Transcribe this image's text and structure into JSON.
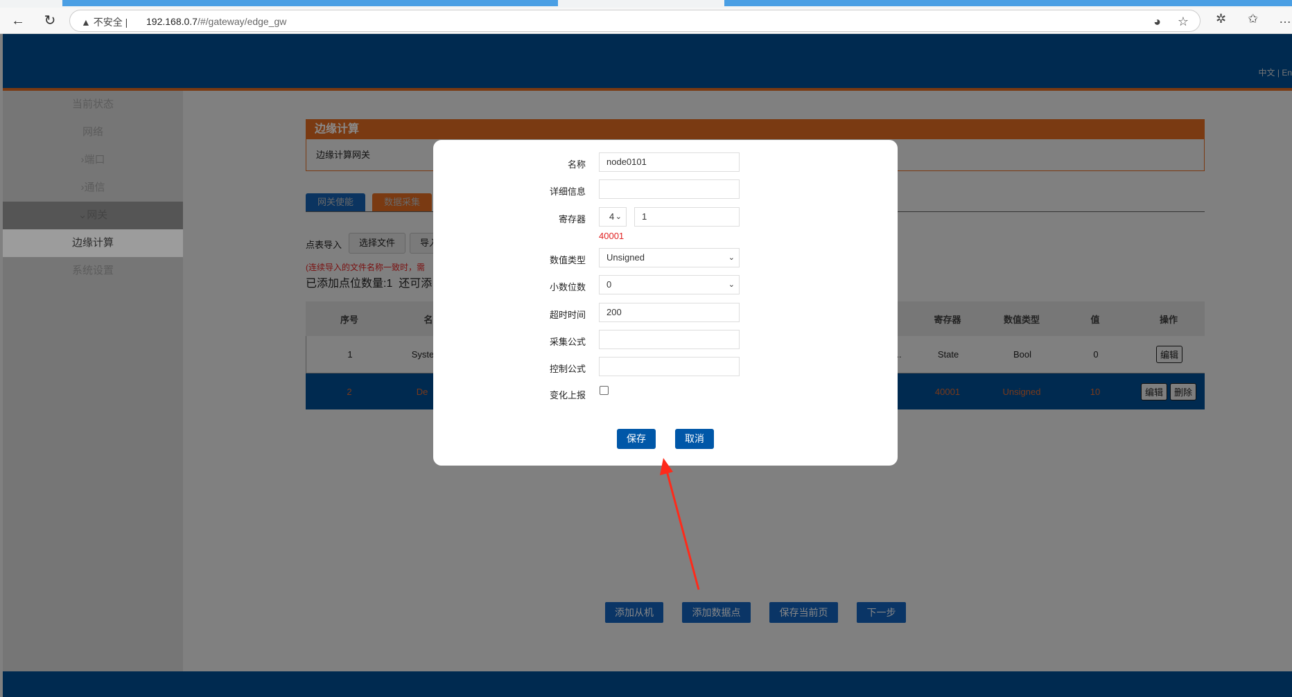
{
  "browser": {
    "security_label": "不安全",
    "url_host": "192.168.0.7",
    "url_path": "/#/gateway/edge_gw"
  },
  "header": {
    "language": "中文 | En"
  },
  "sidebar": {
    "items": [
      {
        "label": "当前状态"
      },
      {
        "label": "网络"
      },
      {
        "label": "›端口"
      },
      {
        "label": "›通信"
      },
      {
        "label": "⌄网关"
      },
      {
        "label": "边缘计算"
      },
      {
        "label": "系统设置"
      }
    ]
  },
  "panel": {
    "title": "边缘计算",
    "subtitle": "边缘计算网关"
  },
  "tabs": [
    {
      "label": "网关使能"
    },
    {
      "label": "数据采集"
    }
  ],
  "import": {
    "label": "点表导入",
    "choose_file": "选择文件",
    "import_btn": "导入",
    "note": "(连续导入的文件名称一致时，需",
    "count": "已添加点位数量:1  还可添"
  },
  "table": {
    "headers": {
      "index": "序号",
      "name": "名",
      "register": "寄存器",
      "type": "数值类型",
      "value": "值",
      "ops": "操作"
    },
    "rows": [
      {
        "index": "1",
        "name": "Syste",
        "name_tail": "..",
        "register": "State",
        "type": "Bool",
        "value": "0",
        "actions": [
          "编辑"
        ]
      },
      {
        "index": "2",
        "name": "De",
        "register": "40001",
        "type": "Unsigned",
        "value": "10",
        "actions": [
          "编辑",
          "删除"
        ]
      }
    ]
  },
  "bottom_buttons": {
    "add_slave": "添加从机",
    "add_point": "添加数据点",
    "save_page": "保存当前页",
    "next": "下一步"
  },
  "modal": {
    "name_label": "名称",
    "name_value": "node0101",
    "detail_label": "详细信息",
    "detail_value": "",
    "register_label": "寄存器",
    "register_type": "4",
    "register_addr": "1",
    "register_hint": "40001",
    "dtype_label": "数值类型",
    "dtype_value": "Unsigned",
    "decimals_label": "小数位数",
    "decimals_value": "0",
    "timeout_label": "超时时间",
    "timeout_value": "200",
    "collect_label": "采集公式",
    "collect_value": "",
    "control_label": "控制公式",
    "control_value": "",
    "report_label": "变化上报",
    "report_checked": false,
    "save": "保存",
    "cancel": "取消"
  },
  "colors": {
    "navy": "#002a50",
    "orange": "#7a3a12",
    "primary": "#0057a8",
    "hint_red": "#e02020",
    "annotation_arrow": "#ff2a1a"
  }
}
